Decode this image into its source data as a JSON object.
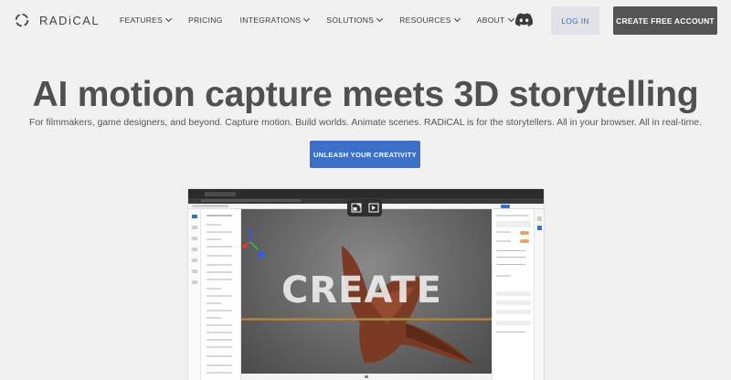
{
  "brand": {
    "name": "RADiCAL"
  },
  "nav": {
    "items": [
      {
        "label": "FEATURES",
        "has_dropdown": true
      },
      {
        "label": "PRICING",
        "has_dropdown": false
      },
      {
        "label": "INTEGRATIONS",
        "has_dropdown": true
      },
      {
        "label": "SOLUTIONS",
        "has_dropdown": true
      },
      {
        "label": "RESOURCES",
        "has_dropdown": true
      },
      {
        "label": "ABOUT",
        "has_dropdown": true
      }
    ],
    "discord_icon": "discord-icon",
    "login_label": "LOG IN",
    "create_account_label": "CREATE FREE ACCOUNT"
  },
  "hero": {
    "title": "AI motion capture meets 3D storytelling",
    "subtitle": "For filmmakers, game designers, and beyond. Capture motion. Build worlds. Animate scenes. RADiCAL is for the storytellers. All in your browser. All in real-time.",
    "cta_label": "UNLEASH YOUR CREATIVITY"
  },
  "preview": {
    "viewport_text": "CREATE",
    "controls": [
      "exit-fullscreen-icon",
      "play-video-icon"
    ]
  },
  "colors": {
    "accent_blue": "#3d71c9",
    "dark_button": "#555555",
    "login_bg": "#e1e3e6",
    "page_bg": "#f1f1f1"
  }
}
